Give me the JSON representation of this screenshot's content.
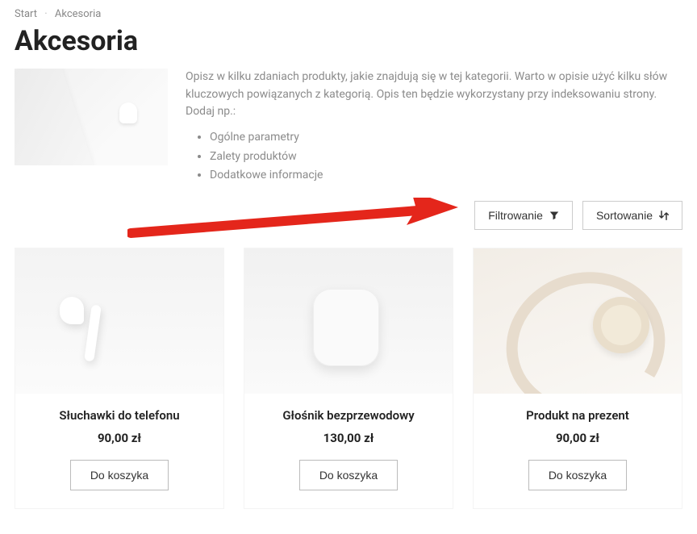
{
  "breadcrumb": {
    "home": "Start",
    "current": "Akcesoria"
  },
  "title": "Akcesoria",
  "description": {
    "intro": "Opisz w kilku zdaniach produkty, jakie znajdują się w tej kategorii. Warto w opisie użyć kilku słów kluczowych powiązanych z kategorią. Opis ten będzie wykorzystany przy indeksowaniu strony. Dodaj np.:",
    "bullets": [
      "Ogólne parametry",
      "Zalety produktów",
      "Dodatkowe informacje"
    ]
  },
  "toolbar": {
    "filter_label": "Filtrowanie",
    "sort_label": "Sortowanie"
  },
  "products": [
    {
      "name": "Słuchawki do telefonu",
      "price": "90,00 zł",
      "cta": "Do koszyka"
    },
    {
      "name": "Głośnik bezprzewodowy",
      "price": "130,00 zł",
      "cta": "Do koszyka"
    },
    {
      "name": "Produkt na prezent",
      "price": "90,00 zł",
      "cta": "Do koszyka"
    }
  ],
  "annotation": {
    "arrow_color": "#e4261b"
  }
}
